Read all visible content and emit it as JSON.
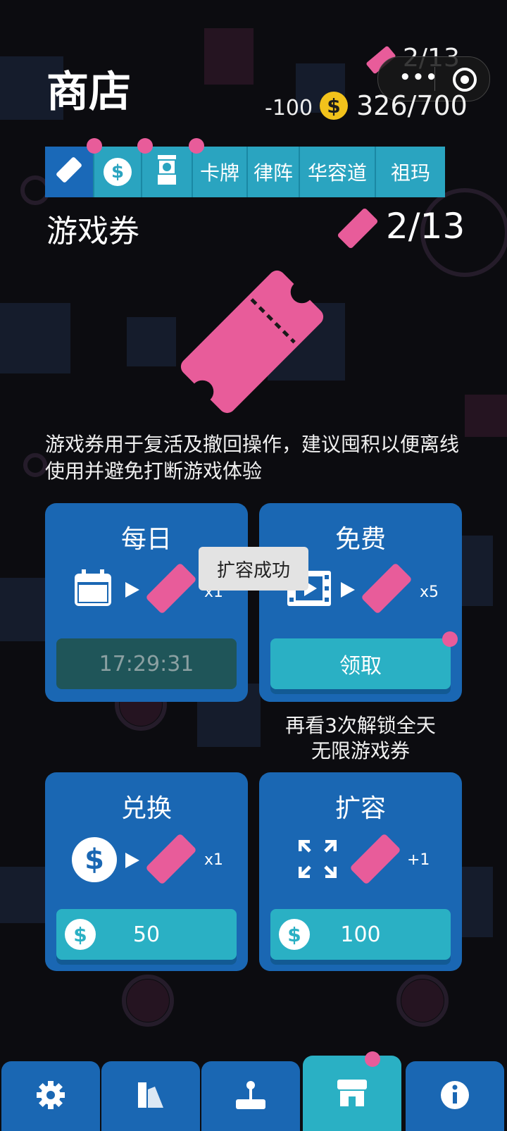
{
  "header": {
    "title": "商店",
    "ticket_count": "2/13",
    "coin_delta": "-100",
    "coin_symbol": "$",
    "coin_count": "326/700"
  },
  "capsule": {
    "menu_label": "•••"
  },
  "tabs": [
    {
      "icon": "ticket-icon",
      "active": true
    },
    {
      "icon": "coin-icon",
      "badge": true,
      "label": "$"
    },
    {
      "icon": "gacha-machine-icon",
      "badge": true
    },
    {
      "label": "卡牌"
    },
    {
      "label": "律阵"
    },
    {
      "label": "华容道"
    },
    {
      "label": "祖玛"
    }
  ],
  "section": {
    "title": "游戏券",
    "count": "2/13",
    "description": "游戏券用于复活及撤回操作，建议囤积以便离线使用并避免打断游戏体验"
  },
  "cards": {
    "daily": {
      "title": "每日",
      "multiplier": "x1",
      "timer": "17:29:31"
    },
    "free": {
      "title": "免费",
      "multiplier": "x5",
      "button": "领取"
    },
    "exchange": {
      "title": "兑换",
      "multiplier": "x1",
      "price": "50",
      "coin_symbol": "$"
    },
    "expand": {
      "title": "扩容",
      "multiplier": "+1",
      "price": "100",
      "coin_symbol": "$"
    }
  },
  "hint": {
    "line1": "再看3次解锁全天",
    "line2": "无限游戏券"
  },
  "toast": "扩容成功",
  "nav": [
    {
      "icon": "settings-icon"
    },
    {
      "icon": "palette-icon"
    },
    {
      "icon": "joystick-icon"
    },
    {
      "icon": "shop-icon",
      "active": true,
      "badge": true
    },
    {
      "icon": "info-icon"
    }
  ],
  "colors": {
    "accent": "#2ab0c4",
    "panel": "#1a67b3",
    "ticket": "#e85c9a",
    "coin": "#f2c21b"
  }
}
